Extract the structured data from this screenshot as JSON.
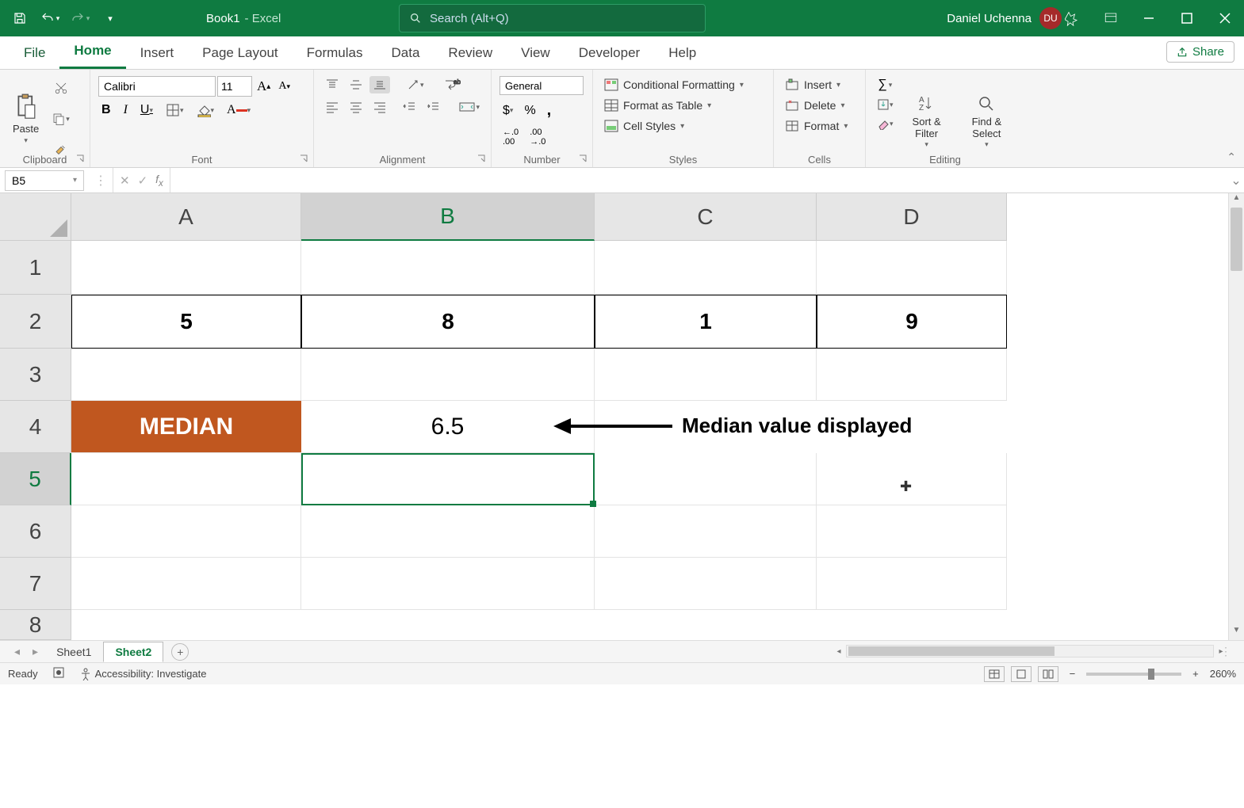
{
  "titlebar": {
    "doc_name": "Book1",
    "app_suffix": " - Excel",
    "search_placeholder": "Search (Alt+Q)",
    "user_name": "Daniel Uchenna",
    "user_initials": "DU"
  },
  "tabs": {
    "file": "File",
    "home": "Home",
    "insert": "Insert",
    "page_layout": "Page Layout",
    "formulas": "Formulas",
    "data": "Data",
    "review": "Review",
    "view": "View",
    "developer": "Developer",
    "help": "Help",
    "share": "Share"
  },
  "ribbon": {
    "clipboard": {
      "label": "Clipboard",
      "paste": "Paste"
    },
    "font": {
      "label": "Font",
      "name": "Calibri",
      "size": "11"
    },
    "alignment": {
      "label": "Alignment"
    },
    "number": {
      "label": "Number",
      "format": "General"
    },
    "styles": {
      "label": "Styles",
      "cond_fmt": "Conditional Formatting",
      "as_table": "Format as Table",
      "cell_styles": "Cell Styles"
    },
    "cells": {
      "label": "Cells",
      "insert": "Insert",
      "delete": "Delete",
      "format": "Format"
    },
    "editing": {
      "label": "Editing",
      "sort_filter": "Sort & Filter",
      "find_select": "Find & Select"
    }
  },
  "formulabar": {
    "cell_ref": "B5",
    "formula": ""
  },
  "grid": {
    "columns": [
      "A",
      "B",
      "C",
      "D"
    ],
    "rows": [
      "1",
      "2",
      "3",
      "4",
      "5",
      "6",
      "7",
      "8"
    ],
    "row2": {
      "A": "5",
      "B": "8",
      "C": "1",
      "D": "9"
    },
    "row4": {
      "A": "MEDIAN",
      "B": "6.5"
    },
    "annotation": "Median value displayed"
  },
  "sheets": {
    "s1": "Sheet1",
    "s2": "Sheet2"
  },
  "statusbar": {
    "ready": "Ready",
    "accessibility": "Accessibility: Investigate",
    "zoom": "260%"
  }
}
